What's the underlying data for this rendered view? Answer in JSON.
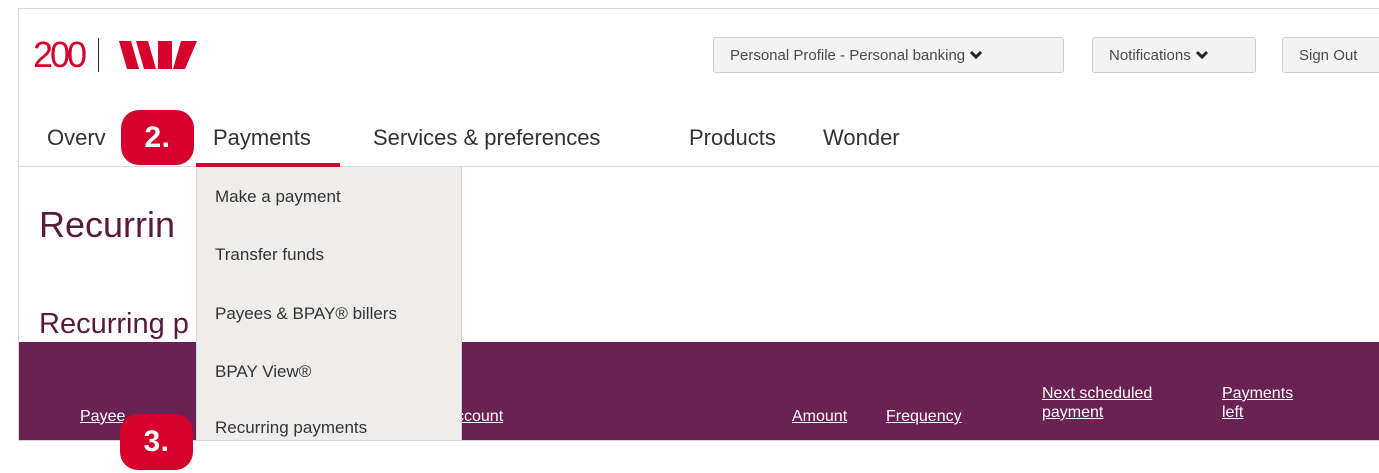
{
  "header": {
    "logo_text": "200",
    "brand_color": "#d5002b",
    "profile_button": "Personal Profile - Personal banking",
    "notifications_button": "Notifications",
    "signout_button": "Sign Out"
  },
  "nav": {
    "items": [
      {
        "label": "Overview",
        "visible_text": "Overv"
      },
      {
        "label": "Payments"
      },
      {
        "label": "Services & preferences"
      },
      {
        "label": "Products"
      },
      {
        "label": "Wonder"
      }
    ],
    "active": "Payments"
  },
  "page": {
    "title": "Recurrin",
    "section_title": "Recurring p"
  },
  "table": {
    "header_color": "#6a2153",
    "columns": {
      "payee": "Payee",
      "account": "ccount",
      "amount": "Amount",
      "frequency": "Frequency",
      "next_scheduled": "Next scheduled payment",
      "payments_left": "Payments left"
    }
  },
  "dropdown": {
    "items": [
      "Make a payment",
      "Transfer funds",
      "Payees & BPAY® billers",
      "BPAY View®",
      "Recurring payments"
    ]
  },
  "annotations": {
    "step2": "2.",
    "step3": "3."
  }
}
